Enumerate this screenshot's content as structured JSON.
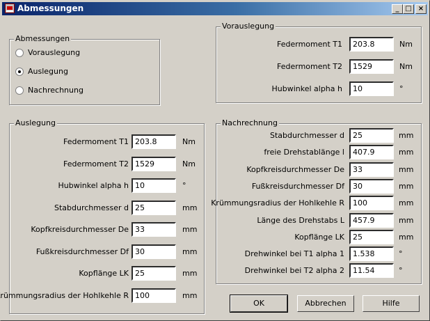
{
  "window": {
    "title": "Abmessungen"
  },
  "titlebar_buttons": [
    "_",
    "□",
    "×"
  ],
  "mode_group": {
    "legend": "Abmessungen",
    "options": [
      {
        "label": "Vorauslegung",
        "selected": false
      },
      {
        "label": "Auslegung",
        "selected": true
      },
      {
        "label": "Nachrechnung",
        "selected": false
      }
    ]
  },
  "vorauslegung": {
    "legend": "Vorauslegung",
    "rows": [
      {
        "label": "Federmoment T1",
        "value": "203.8",
        "unit": "Nm"
      },
      {
        "label": "Federmoment T2",
        "value": "1529",
        "unit": "Nm"
      },
      {
        "label": "Hubwinkel alpha h",
        "value": "10",
        "unit": "°"
      }
    ]
  },
  "auslegung": {
    "legend": "Auslegung",
    "rows": [
      {
        "label": "Federmoment T1",
        "value": "203.8",
        "unit": "Nm"
      },
      {
        "label": "Federmoment T2",
        "value": "1529",
        "unit": "Nm"
      },
      {
        "label": "Hubwinkel alpha h",
        "value": "10",
        "unit": "°"
      },
      {
        "label": "Stabdurchmesser d",
        "value": "25",
        "unit": "mm"
      },
      {
        "label": "Kopfkreisdurchmesser De",
        "value": "33",
        "unit": "mm"
      },
      {
        "label": "Fußkreisdurchmesser Df",
        "value": "30",
        "unit": "mm"
      },
      {
        "label": "Kopflänge LK",
        "value": "25",
        "unit": "mm"
      },
      {
        "label": "Krümmungsradius der Hohlkehle R",
        "value": "100",
        "unit": "mm"
      }
    ]
  },
  "nachrechnung": {
    "legend": "Nachrechnung",
    "rows": [
      {
        "label": "Stabdurchmesser d",
        "value": "25",
        "unit": "mm"
      },
      {
        "label": "freie Drehstablänge l",
        "value": "407.9",
        "unit": "mm"
      },
      {
        "label": "Kopfkreisdurchmesser De",
        "value": "33",
        "unit": "mm"
      },
      {
        "label": "Fußkreisdurchmesser Df",
        "value": "30",
        "unit": "mm"
      },
      {
        "label": "Krümmungsradius der Hohlkehle R",
        "value": "100",
        "unit": "mm"
      },
      {
        "label": "Länge des Drehstabs L",
        "value": "457.9",
        "unit": "mm"
      },
      {
        "label": "Kopflänge LK",
        "value": "25",
        "unit": "mm"
      },
      {
        "label": "Drehwinkel bei T1  alpha 1",
        "value": "1.538",
        "unit": "°"
      },
      {
        "label": "Drehwinkel bei T2  alpha 2",
        "value": "11.54",
        "unit": "°"
      }
    ]
  },
  "buttons": {
    "ok": "OK",
    "cancel": "Abbrechen",
    "help": "Hilfe"
  }
}
